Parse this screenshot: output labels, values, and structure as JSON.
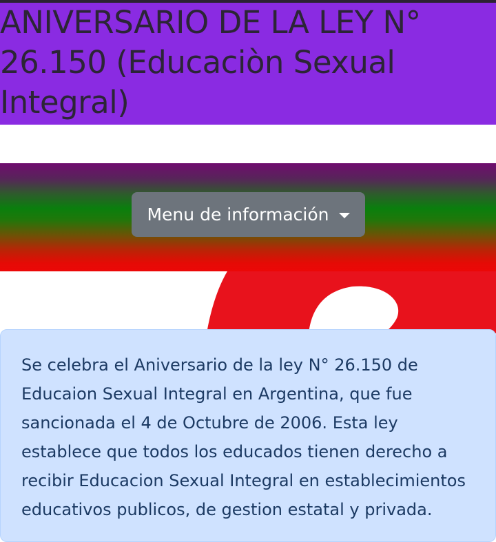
{
  "header": {
    "title": "ANIVERSARIO DE LA LEY N° 26.150 (Educaciòn Sexual Integral)"
  },
  "menu": {
    "dropdown_label": "Menu de información"
  },
  "info": {
    "text": "Se celebra el Aniversario de la ley N° 26.150 de Educaion Sexual Integral en Argentina, que fue sancionada el 4 de Octubre de 2006. Esta ley establece que todos los educados tienen derecho a recibir Educacion Sexual Integral en establecimientos educativos publicos, de gestion estatal y privada."
  },
  "colors": {
    "header_bg": "#8a2be2",
    "dropdown_bg": "#6d747c",
    "info_bg": "#cfe2ff",
    "info_text": "#1c3a63"
  }
}
